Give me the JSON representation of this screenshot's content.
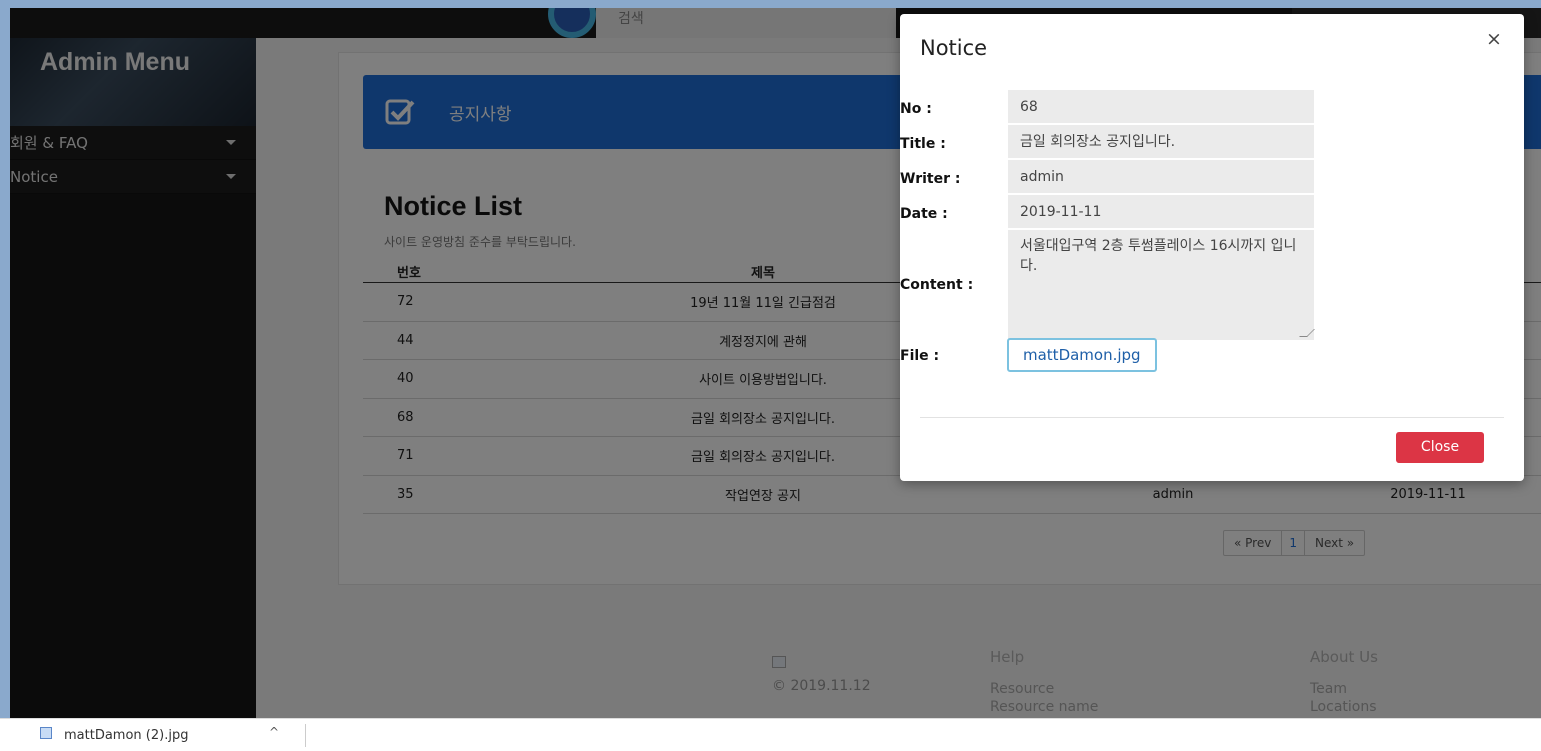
{
  "header": {
    "search_placeholder": "검색"
  },
  "sidebar": {
    "title": "Admin Menu",
    "items": [
      {
        "label": "회원 & FAQ"
      },
      {
        "label": "Notice"
      }
    ]
  },
  "main": {
    "banner_title": "공지사항",
    "list_title": "Notice List",
    "list_subtitle": "사이트 운영방침 준수를 부탁드립니다.",
    "table": {
      "headers": {
        "no": "번호",
        "title": "제목"
      },
      "rows": [
        {
          "no": "72",
          "title": "19년 11월 11일 긴급점검",
          "writer": "",
          "date": ""
        },
        {
          "no": "44",
          "title": "계정정지에 관해",
          "writer": "",
          "date": ""
        },
        {
          "no": "40",
          "title": "사이트 이용방법입니다.",
          "writer": "",
          "date": ""
        },
        {
          "no": "68",
          "title": "금일 회의장소 공지입니다.",
          "writer": "",
          "date": ""
        },
        {
          "no": "71",
          "title": "금일 회의장소 공지입니다.",
          "writer": "",
          "date": ""
        },
        {
          "no": "35",
          "title": "작업연장 공지",
          "writer": "admin",
          "date": "2019-11-11"
        }
      ]
    },
    "pager": {
      "prev": "« Prev",
      "current": "1",
      "next": "Next »"
    }
  },
  "footer": {
    "copyright": "© 2019.11.12",
    "help": {
      "heading": "Help",
      "links": [
        "Resource",
        "Resource name"
      ]
    },
    "about": {
      "heading": "About Us",
      "links": [
        "Team",
        "Locations"
      ]
    }
  },
  "modal": {
    "title": "Notice",
    "close_x": "×",
    "fields": {
      "no_label": "No :",
      "no_value": "68",
      "title_label": "Title :",
      "title_value": "금일 회의장소 공지입니다.",
      "writer_label": "Writer :",
      "writer_value": "admin",
      "date_label": "Date :",
      "date_value": "2019-11-11",
      "content_label": "Content :",
      "content_value": "서울대입구역 2층 투썸플레이스 16시까지 입니다.",
      "file_label": "File :",
      "file_value": "mattDamon.jpg"
    },
    "close_button": "Close"
  },
  "download_bar": {
    "file_name": "mattDamon (2).jpg",
    "chevron": "^"
  },
  "colors": {
    "accent": "#1e6fd9",
    "danger": "#dc3545",
    "sidebar": "#161616"
  }
}
